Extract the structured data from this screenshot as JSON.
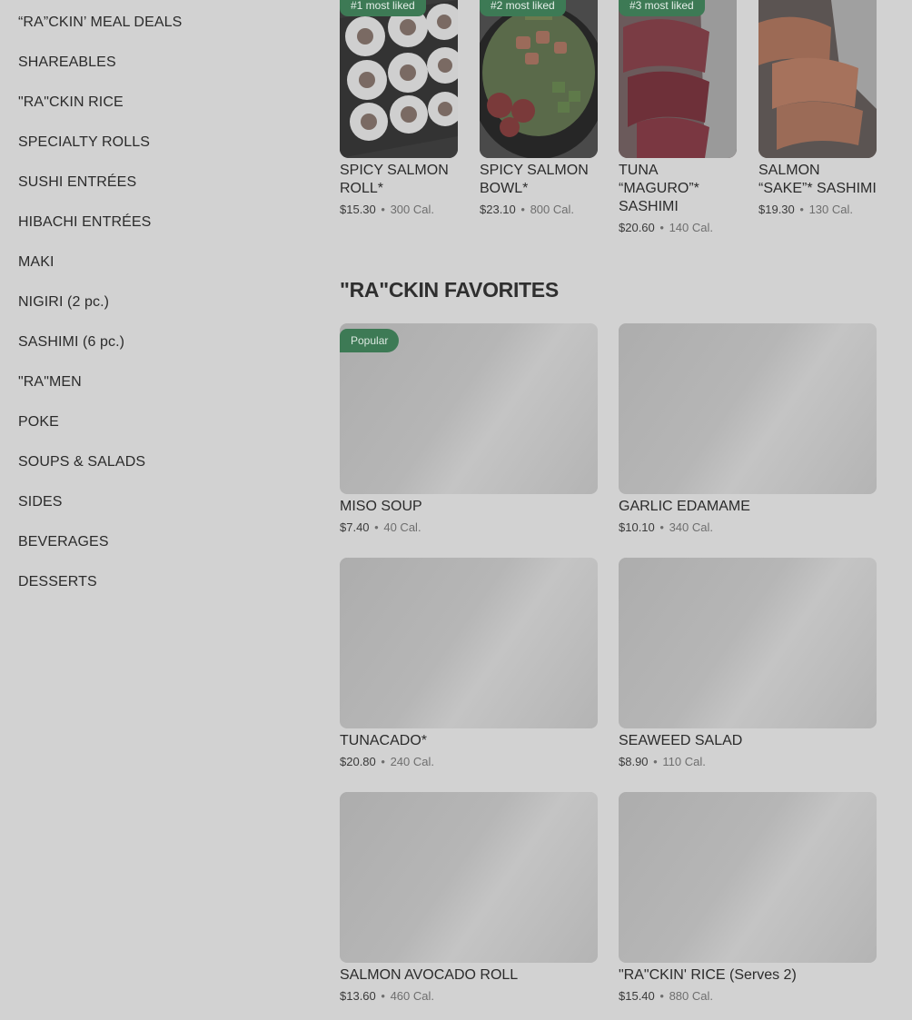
{
  "sidebar": {
    "items": [
      "“RA”CKIN’ MEAL DEALS",
      "SHAREABLES",
      "\"RA\"CKIN RICE",
      "SPECIALTY ROLLS",
      "SUSHI ENTRÉES",
      "HIBACHI ENTRÉES",
      "MAKI",
      "NIGIRI (2 pc.)",
      "SASHIMI (6 pc.)",
      "\"RA\"MEN",
      "POKE",
      "SOUPS & SALADS",
      "SIDES",
      "BEVERAGES",
      "DESSERTS"
    ]
  },
  "most_liked": [
    {
      "badge": "#1 most liked",
      "name": "SPICY SALMON ROLL*",
      "price": "$15.30",
      "calories": "300 Cal."
    },
    {
      "badge": "#2 most liked",
      "name": "SPICY SALMON BOWL*",
      "price": "$23.10",
      "calories": "800 Cal."
    },
    {
      "badge": "#3 most liked",
      "name": "TUNA “MAGURO”* SASHIMI",
      "price": "$20.60",
      "calories": "140 Cal."
    },
    {
      "badge": "",
      "name": "SALMON “SAKE”* SASHIMI",
      "price": "$19.30",
      "calories": "130 Cal."
    }
  ],
  "favorites": {
    "title": "\"RA\"CKIN FAVORITES",
    "popular_badge": "Popular",
    "items": [
      {
        "name": "MISO SOUP",
        "price": "$7.40",
        "calories": "40 Cal."
      },
      {
        "name": "GARLIC EDAMAME",
        "price": "$10.10",
        "calories": "340 Cal."
      },
      {
        "name": "TUNACADO*",
        "price": "$20.80",
        "calories": "240 Cal."
      },
      {
        "name": "SEAWEED SALAD",
        "price": "$8.90",
        "calories": "110 Cal."
      },
      {
        "name": "SALMON AVOCADO ROLL",
        "price": "$13.60",
        "calories": "460 Cal."
      },
      {
        "name": "\"RA\"CKIN' RICE (Serves 2)",
        "price": "$15.40",
        "calories": "880 Cal."
      }
    ]
  },
  "separator": "•"
}
